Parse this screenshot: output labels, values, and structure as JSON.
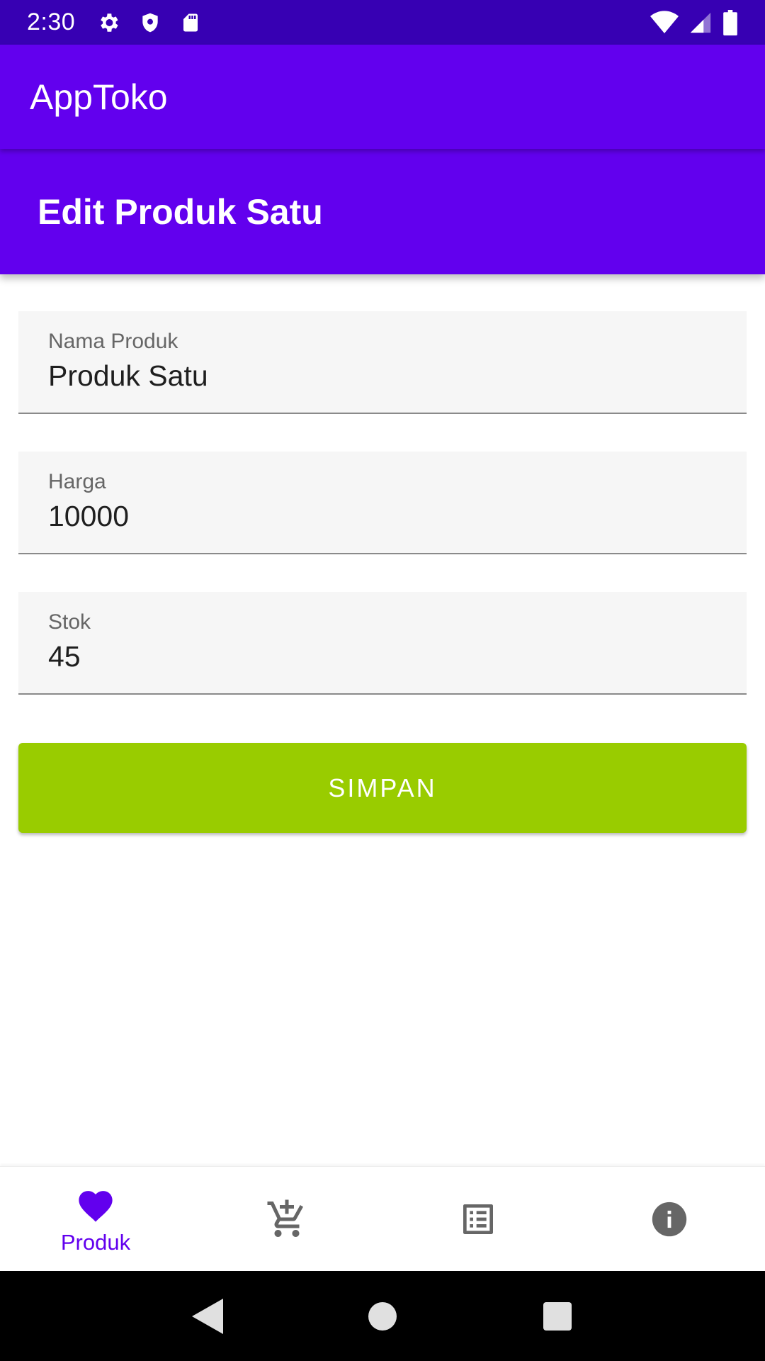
{
  "status_bar": {
    "time": "2:30",
    "left_icons": [
      "settings-icon",
      "shield-icon",
      "sd-card-icon"
    ],
    "right_icons": [
      "wifi-icon",
      "cell-signal-icon",
      "battery-icon"
    ]
  },
  "app_bar": {
    "title": "AppToko"
  },
  "page_header": {
    "title": "Edit Produk Satu"
  },
  "form": {
    "fields": [
      {
        "label": "Nama Produk",
        "value": "Produk Satu"
      },
      {
        "label": "Harga",
        "value": "10000"
      },
      {
        "label": "Stok",
        "value": "45"
      }
    ],
    "save_label": "SIMPAN"
  },
  "bottom_nav": {
    "items": [
      {
        "icon": "heart-icon",
        "label": "Produk",
        "active": true
      },
      {
        "icon": "add-to-cart-icon",
        "label": "",
        "active": false
      },
      {
        "icon": "list-icon",
        "label": "",
        "active": false
      },
      {
        "icon": "info-icon",
        "label": "",
        "active": false
      }
    ]
  },
  "system_nav": {
    "buttons": [
      "back-icon",
      "home-icon",
      "recents-icon"
    ]
  },
  "colors": {
    "status_bar": "#3700b3",
    "primary": "#6200ee",
    "button": "#99cc00",
    "nav_inactive_icon": "#666666"
  }
}
